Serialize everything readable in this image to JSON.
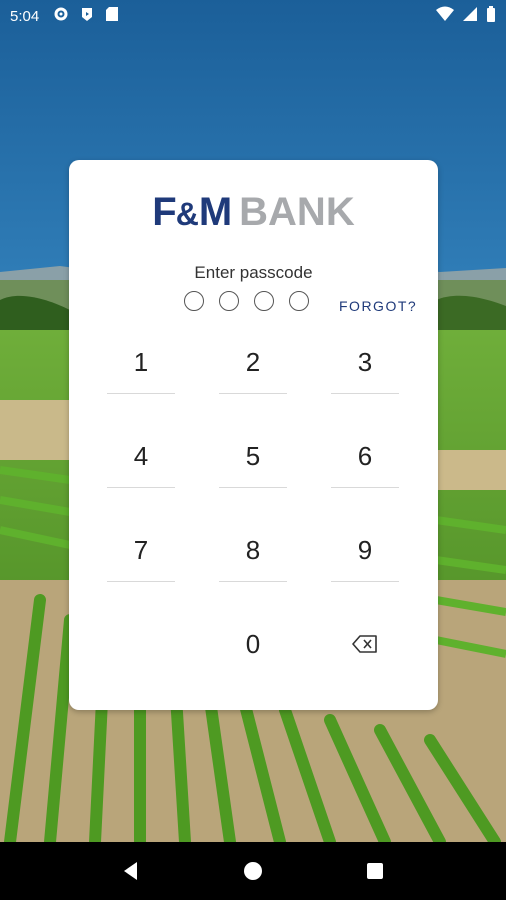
{
  "status_bar": {
    "time": "5:04"
  },
  "logo": {
    "part1_f": "F",
    "part1_amp": "&",
    "part1_m": "M",
    "part2": "BANK"
  },
  "passcode": {
    "prompt": "Enter passcode",
    "dot_count": 4,
    "forgot_label": "FORGOT?"
  },
  "keypad": {
    "keys": [
      "1",
      "2",
      "3",
      "4",
      "5",
      "6",
      "7",
      "8",
      "9",
      "",
      "0",
      "backspace-icon"
    ]
  },
  "colors": {
    "brand_navy": "#1f3a7a",
    "brand_gray": "#a7a9ac"
  },
  "nav_bar": {
    "buttons": [
      "back-icon",
      "home-icon",
      "recents-icon"
    ]
  }
}
